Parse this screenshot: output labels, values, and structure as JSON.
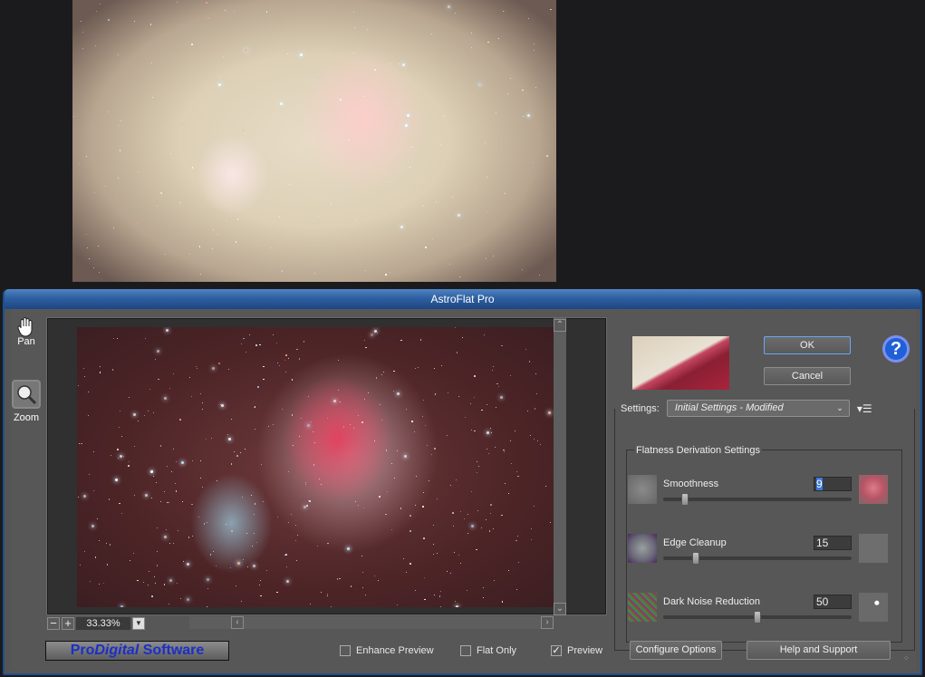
{
  "window": {
    "title": "AstroFlat Pro"
  },
  "tools": [
    {
      "label": "Pan",
      "icon": "hand-icon"
    },
    {
      "label": "Zoom",
      "icon": "magnifier-icon"
    }
  ],
  "view": {
    "zoom_level": "33.33%",
    "zoom_out": "−",
    "zoom_in": "+",
    "scroll_up": "⌃",
    "scroll_down": "⌄",
    "scroll_left": "‹",
    "scroll_right": "›"
  },
  "logo": {
    "pro": "Pro",
    "digital": "Digital",
    "software": " Software"
  },
  "options": [
    {
      "label": "Enhance Preview",
      "checked": false
    },
    {
      "label": "Flat Only",
      "checked": false
    },
    {
      "label": "Preview",
      "checked": true
    }
  ],
  "buttons": {
    "ok": "OK",
    "cancel": "Cancel",
    "configure": "Configure Options",
    "help_support": "Help and Support",
    "help_icon": "?"
  },
  "settings": {
    "label": "Settings:",
    "selected": "Initial Settings - Modified",
    "caret": "⌄",
    "menu_icon": "▾☰"
  },
  "flatness": {
    "title": "Flatness Derivation Settings",
    "params": [
      {
        "label": "Smoothness",
        "value": "9",
        "fraction": 0.1
      },
      {
        "label": "Edge Cleanup",
        "value": "15",
        "fraction": 0.16
      },
      {
        "label": "Dark Noise Reduction",
        "value": "50",
        "fraction": 0.5
      }
    ]
  },
  "colors": {
    "accent": "#1f5fd8",
    "titlebar": "#2e5fa0",
    "logo_text": "#1b2fc8"
  }
}
